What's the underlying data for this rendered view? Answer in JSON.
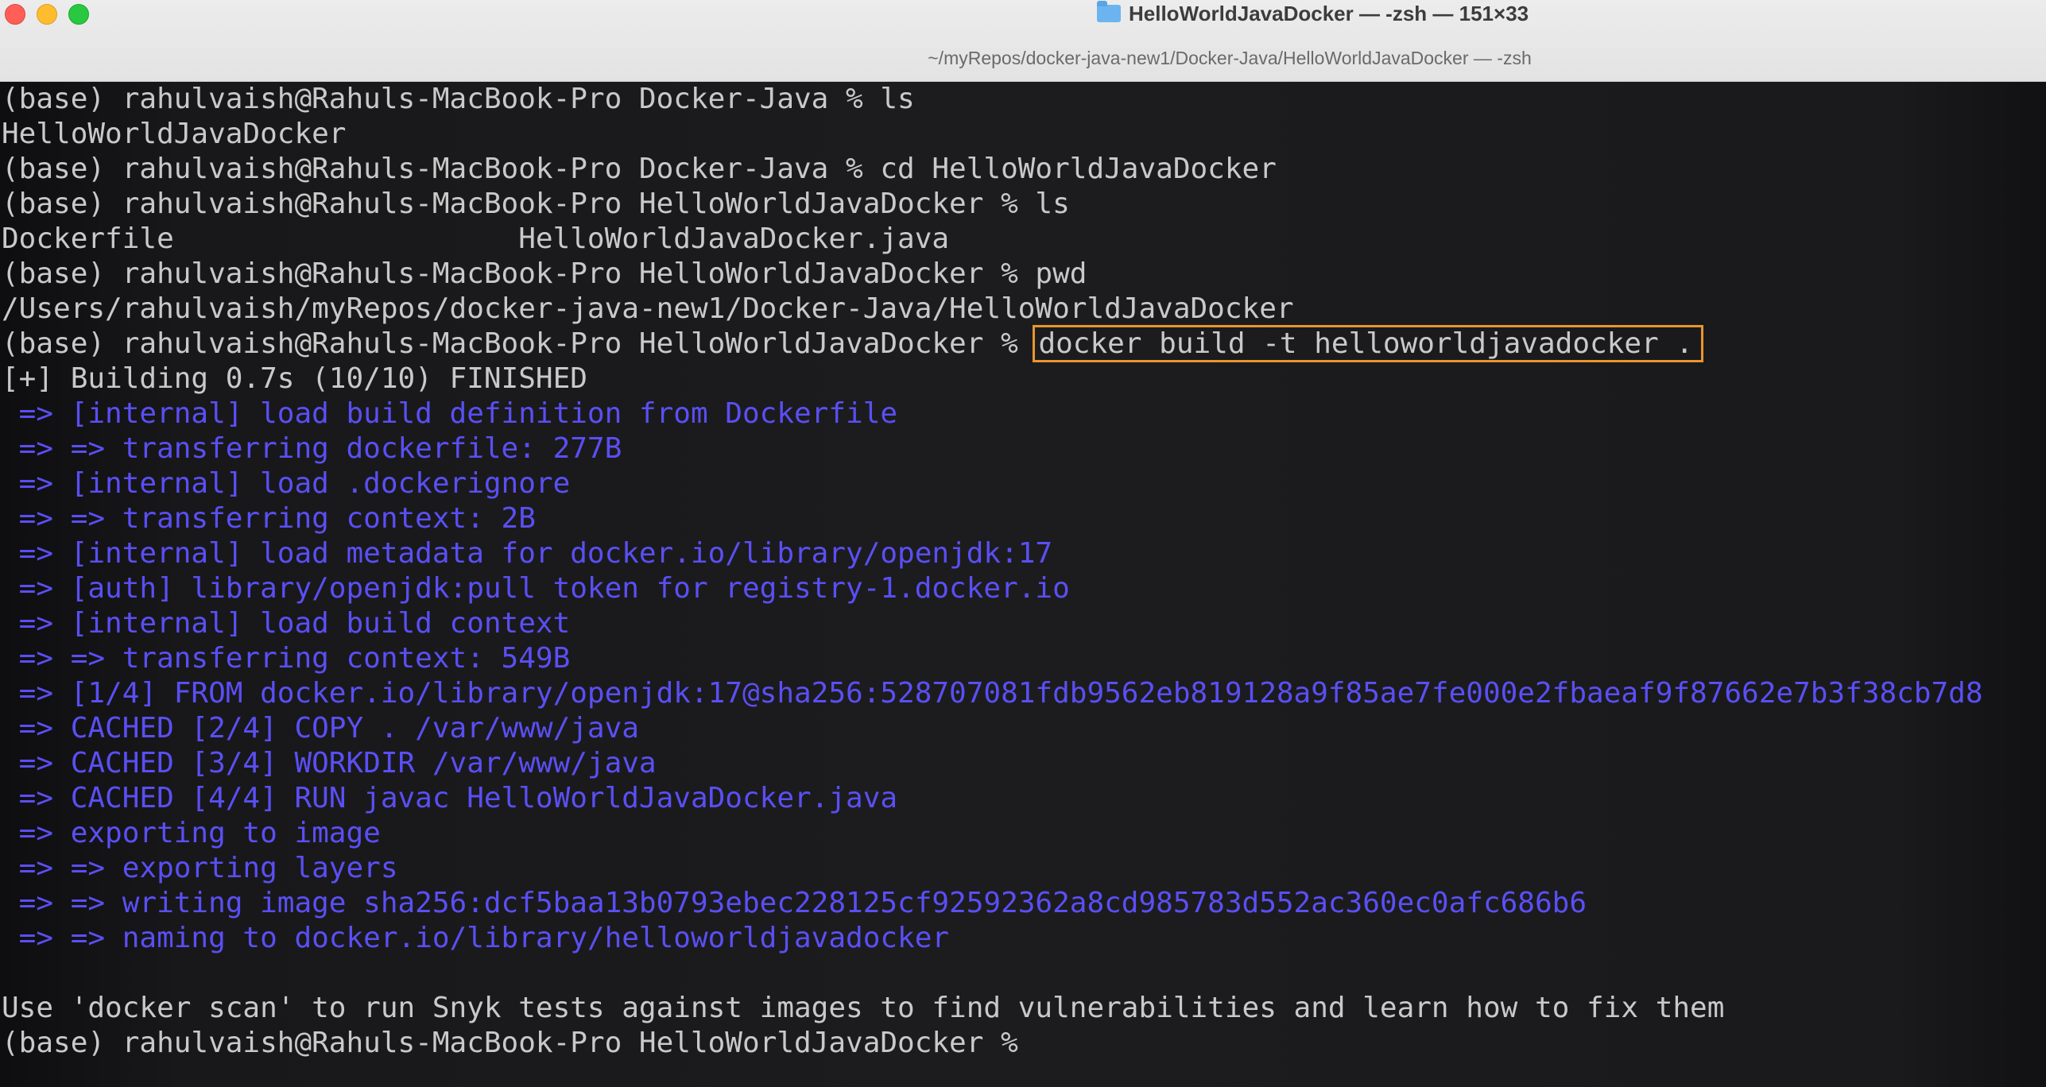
{
  "window": {
    "title": "HelloWorldJavaDocker — -zsh — 151×33",
    "subtitle": "~/myRepos/docker-java-new1/Docker-Java/HelloWorldJavaDocker — -zsh"
  },
  "terminal": {
    "lines": [
      {
        "text": "(base) rahulvaish@Rahuls-MacBook-Pro Docker-Java % ls"
      },
      {
        "text": "HelloWorldJavaDocker"
      },
      {
        "text": "(base) rahulvaish@Rahuls-MacBook-Pro Docker-Java % cd HelloWorldJavaDocker"
      },
      {
        "text": "(base) rahulvaish@Rahuls-MacBook-Pro HelloWorldJavaDocker % ls"
      },
      {
        "text": "Dockerfile                    HelloWorldJavaDocker.java"
      },
      {
        "text": "(base) rahulvaish@Rahuls-MacBook-Pro HelloWorldJavaDocker % pwd"
      },
      {
        "text": "/Users/rahulvaish/myRepos/docker-java-new1/Docker-Java/HelloWorldJavaDocker"
      },
      {
        "text": "(base) rahulvaish@Rahuls-MacBook-Pro HelloWorldJavaDocker % ",
        "command": "docker build -t helloworldjavadocker ."
      },
      {
        "text": "[+] Building 0.7s (10/10) FINISHED"
      },
      {
        "text": " => [internal] load build definition from Dockerfile",
        "color": "blue"
      },
      {
        "text": " => => transferring dockerfile: 277B",
        "color": "blue"
      },
      {
        "text": " => [internal] load .dockerignore",
        "color": "blue"
      },
      {
        "text": " => => transferring context: 2B",
        "color": "blue"
      },
      {
        "text": " => [internal] load metadata for docker.io/library/openjdk:17",
        "color": "blue"
      },
      {
        "text": " => [auth] library/openjdk:pull token for registry-1.docker.io",
        "color": "blue"
      },
      {
        "text": " => [internal] load build context",
        "color": "blue"
      },
      {
        "text": " => => transferring context: 549B",
        "color": "blue"
      },
      {
        "text": " => [1/4] FROM docker.io/library/openjdk:17@sha256:528707081fdb9562eb819128a9f85ae7fe000e2fbaeaf9f87662e7b3f38cb7d8",
        "color": "blue"
      },
      {
        "text": " => CACHED [2/4] COPY . /var/www/java",
        "color": "blue"
      },
      {
        "text": " => CACHED [3/4] WORKDIR /var/www/java",
        "color": "blue"
      },
      {
        "text": " => CACHED [4/4] RUN javac HelloWorldJavaDocker.java",
        "color": "blue"
      },
      {
        "text": " => exporting to image",
        "color": "blue"
      },
      {
        "text": " => => exporting layers",
        "color": "blue"
      },
      {
        "text": " => => writing image sha256:dcf5baa13b0793ebec228125cf92592362a8cd985783d552ac360ec0afc686b6",
        "color": "blue"
      },
      {
        "text": " => => naming to docker.io/library/helloworldjavadocker",
        "color": "blue"
      },
      {
        "text": ""
      },
      {
        "text": "Use 'docker scan' to run Snyk tests against images to find vulnerabilities and learn how to fix them"
      },
      {
        "text": "(base) rahulvaish@Rahuls-MacBook-Pro HelloWorldJavaDocker % "
      }
    ]
  },
  "colors": {
    "normal_text": "#c9c9c9",
    "build_step_text": "#5a4ff5",
    "highlight_box": "#e89530"
  },
  "icons": {
    "title_icon": "folder-icon"
  }
}
